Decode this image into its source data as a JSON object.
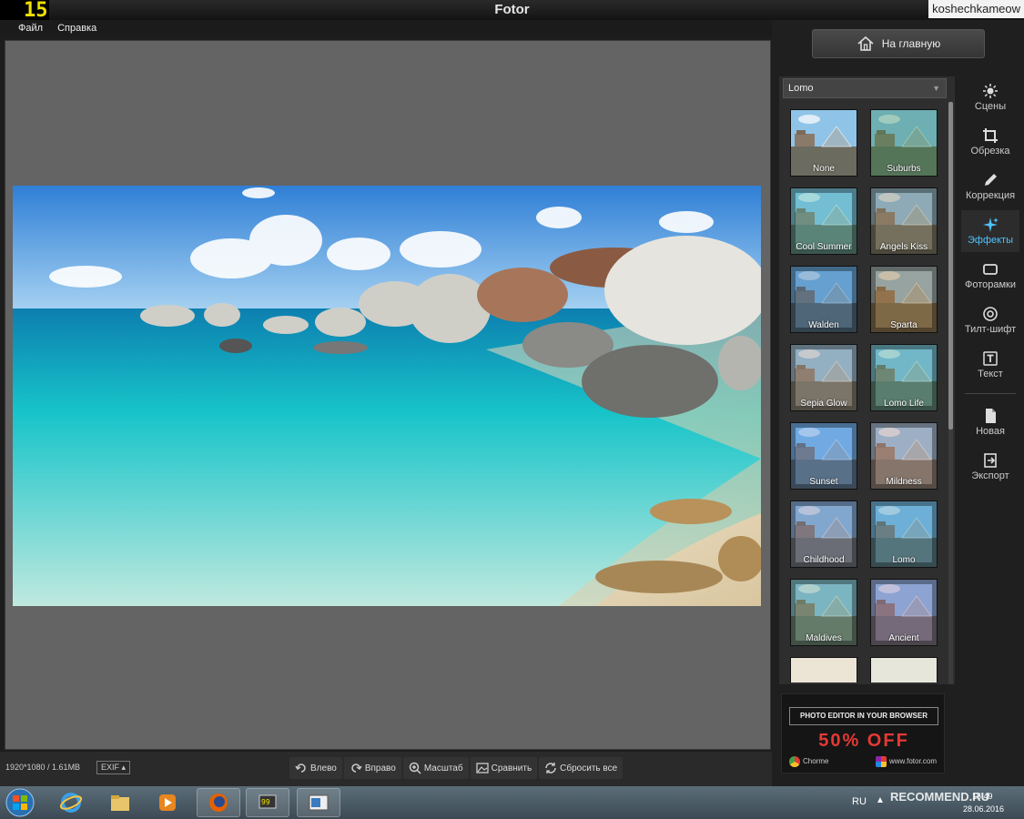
{
  "window": {
    "title": "Fotor",
    "fps_counter": "15",
    "watermark_user": "koshechkameow"
  },
  "menu": {
    "items": [
      "Файл",
      "Справка"
    ]
  },
  "status": {
    "image_info": "1920*1080 / 1.61MB",
    "exif_label": "EXIF ▴"
  },
  "toolbar": {
    "items": [
      {
        "label": "Влево",
        "icon": "rotate-left-icon"
      },
      {
        "label": "Вправо",
        "icon": "rotate-right-icon"
      },
      {
        "label": "Масштаб",
        "icon": "zoom-icon"
      },
      {
        "label": "Сравнить",
        "icon": "compare-icon"
      },
      {
        "label": "Сбросить все",
        "icon": "reset-icon"
      }
    ]
  },
  "home_button": {
    "label": "На главную",
    "icon": "home-icon"
  },
  "filters": {
    "selected_category": "Lomo",
    "items": [
      "None",
      "Suburbs",
      "Cool Summer",
      "Angels Kiss",
      "Walden",
      "Sparta",
      "Sepia Glow",
      "Lomo Life",
      "Sunset",
      "Mildness",
      "Childhood",
      "Lomo",
      "Maldives",
      "Ancient",
      "",
      ""
    ]
  },
  "tools": {
    "items": [
      {
        "label": "Сцены",
        "icon": "sun-icon",
        "active": false
      },
      {
        "label": "Обрезка",
        "icon": "crop-icon",
        "active": false
      },
      {
        "label": "Коррекция",
        "icon": "pencil-icon",
        "active": false
      },
      {
        "label": "Эффекты",
        "icon": "sparkle-icon",
        "active": true
      },
      {
        "label": "Фоторамки",
        "icon": "frame-icon",
        "active": false
      },
      {
        "label": "Тилт-шифт",
        "icon": "tilt-shift-icon",
        "active": false
      },
      {
        "label": "Текст",
        "icon": "text-icon",
        "active": false
      }
    ],
    "bottom_items": [
      {
        "label": "Новая",
        "icon": "new-file-icon"
      },
      {
        "label": "Экспорт",
        "icon": "export-icon"
      }
    ]
  },
  "ad": {
    "headline": "PHOTO EDITOR IN YOUR BROWSER",
    "offer": "50% OFF",
    "left_text": "Chorme",
    "right_text": "www.fotor.com"
  },
  "taskbar": {
    "lang": "RU",
    "date": "28.06.2016",
    "time": "16:49",
    "overlay": "RECOMMEND.RU"
  },
  "colors": {
    "accent": "#4fc3ff",
    "ad_red": "#e53935"
  }
}
